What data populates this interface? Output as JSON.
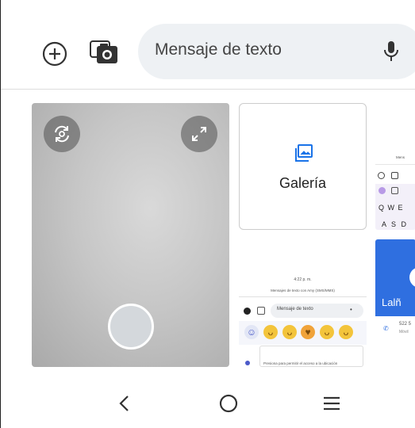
{
  "compose": {
    "add_icon": "plus-circle-icon",
    "camera_icon": "camera-icon",
    "placeholder": "Mensaje de texto",
    "mic_icon": "mic-icon"
  },
  "media": {
    "camera": {
      "switch_icon": "switch-camera-icon",
      "expand_icon": "expand-icon",
      "shutter_icon": "shutter-button"
    },
    "gallery": {
      "icon": "gallery-icon",
      "label": "Galería"
    },
    "screenshot_left": {
      "time": "4:22 p. m.",
      "header": "Mensajes de texto con Amy (SMS/MMS)",
      "input_placeholder": "Mensaje de texto",
      "location_text": "Presiona para permitir el acceso a la ubicación"
    },
    "screenshot_right_top": {
      "title": "Mens",
      "keys": "Q W E",
      "keys2": "A S D"
    },
    "screenshot_right_bottom": {
      "name": "Lalñ",
      "number": "522 5",
      "type": "Móvil"
    }
  },
  "navbar": {
    "back_icon": "back-icon",
    "home_icon": "home-icon",
    "recents_icon": "recents-icon"
  }
}
